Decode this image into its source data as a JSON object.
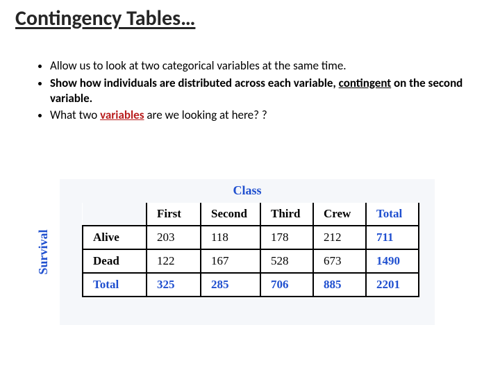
{
  "title": "Contingency Tables…",
  "bullets": {
    "b1": "Allow us to look at two categorical variables at the same time.",
    "b2_pre": "Show how individuals are distributed across each variable, ",
    "b2_contingent": "contingent",
    "b2_post": " on the second variable.",
    "b3_pre": "What two ",
    "b3_var": "variables",
    "b3_post": " are we looking at here? ?"
  },
  "axis": {
    "col": "Class",
    "row": "Survival"
  },
  "headers": {
    "first": "First",
    "second": "Second",
    "third": "Third",
    "crew": "Crew",
    "total": "Total"
  },
  "rows": {
    "alive": {
      "label": "Alive",
      "first": "203",
      "second": "118",
      "third": "178",
      "crew": "212",
      "total": "711"
    },
    "dead": {
      "label": "Dead",
      "first": "122",
      "second": "167",
      "third": "528",
      "crew": "673",
      "total": "1490"
    },
    "total": {
      "label": "Total",
      "first": "325",
      "second": "285",
      "third": "706",
      "crew": "885",
      "total": "2201"
    }
  },
  "chart_data": {
    "type": "table",
    "row_variable": "Survival",
    "col_variable": "Class",
    "columns": [
      "First",
      "Second",
      "Third",
      "Crew",
      "Total"
    ],
    "rows": [
      {
        "name": "Alive",
        "values": [
          203,
          118,
          178,
          212,
          711
        ]
      },
      {
        "name": "Dead",
        "values": [
          122,
          167,
          528,
          673,
          1490
        ]
      },
      {
        "name": "Total",
        "values": [
          325,
          285,
          706,
          885,
          2201
        ]
      }
    ]
  }
}
